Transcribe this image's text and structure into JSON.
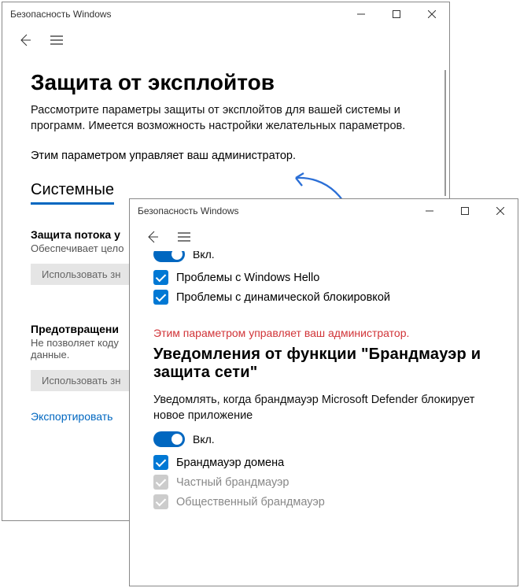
{
  "win1": {
    "title": "Безопасность Windows",
    "heading": "Защита от эксплойтов",
    "desc": "Рассмотрите параметры защиты от эксплойтов для вашей системы и программ. Имеется возможность настройки желательных параметров.",
    "admin_note": "Этим параметром управляет ваш администратор.",
    "tab_label": "Системные",
    "section1_title": "Защита потока у",
    "section1_desc": "Обеспечивает цело",
    "dd1": "Использовать зн",
    "section2_title": "Предотвращени",
    "section2_desc": "Не позволяет коду\nданные.",
    "dd2": "Использовать зн",
    "export_link": "Экспортировать"
  },
  "win2": {
    "title": "Безопасность Windows",
    "toggle_on_label": "Вкл.",
    "cb_hello": "Проблемы с Windows Hello",
    "cb_dynlock": "Проблемы с динамической блокировкой",
    "admin_red": "Этим параметром управляет ваш администратор.",
    "section_heading": "Уведомления от функции \"Брандмауэр и защита сети\"",
    "notify_desc": "Уведомлять, когда брандмауэр Microsoft Defender блокирует новое приложение",
    "toggle2_label": "Вкл.",
    "cb_domain": "Брандмауэр домена",
    "cb_private": "Частный брандмауэр",
    "cb_public": "Общественный брандмауэр"
  }
}
